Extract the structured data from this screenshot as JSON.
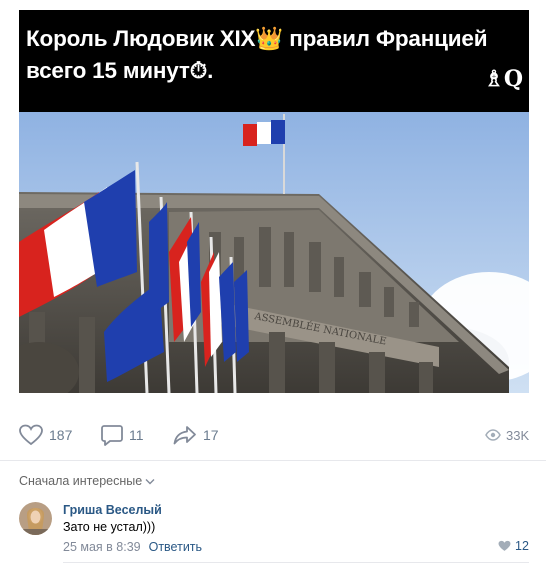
{
  "post": {
    "caption_line1": "Король Людовик XIX👑 правил Францией",
    "caption_line2": "всего 15 минут⏱.",
    "watermark": "♗Q",
    "image_banner_text": "ASSEMBLÉE NATIONALE"
  },
  "actions": {
    "likes": "187",
    "comments": "11",
    "shares": "17",
    "views": "33K"
  },
  "comments": {
    "sort_label": "Сначала интересные",
    "items": [
      {
        "author": "Гриша Веселый",
        "text": "Зато не устал)))",
        "date": "25 мая в 8:39",
        "reply_label": "Ответить",
        "likes": "12"
      }
    ]
  },
  "colors": {
    "link": "#2a5885",
    "action_gray": "#6b7c8f",
    "divider": "#e7e8ec",
    "flag_blue": "#1f3fae",
    "flag_red": "#d8231e"
  }
}
